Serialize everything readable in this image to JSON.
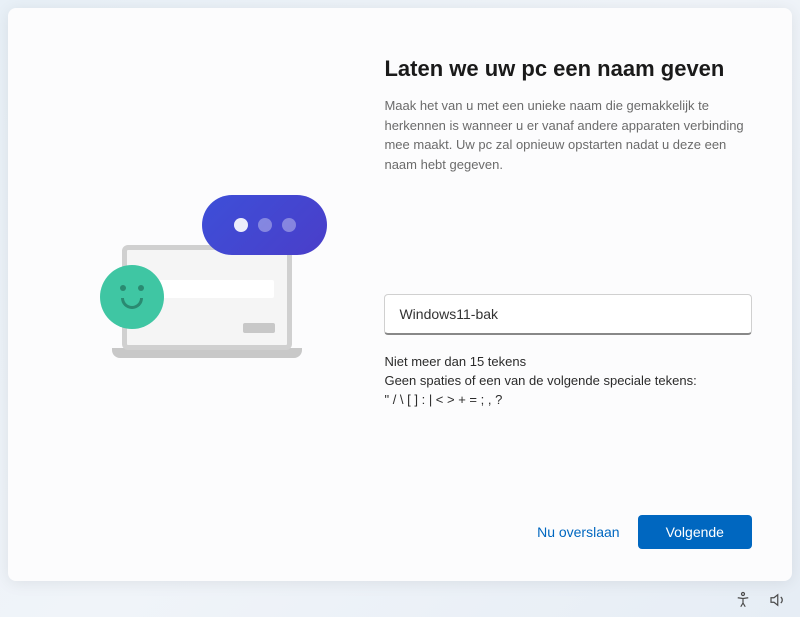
{
  "header": {
    "title": "Laten we uw pc een naam geven",
    "description": "Maak het van u met een unieke naam die gemakkelijk te herkennen is wanneer u er vanaf andere apparaten verbinding mee maakt. Uw pc zal opnieuw opstarten nadat u deze een naam hebt gegeven."
  },
  "form": {
    "pc_name_value": "Windows11-bak",
    "constraint_line1": "Niet meer dan 15 tekens",
    "constraint_line2": "Geen spaties of een van de volgende speciale tekens:",
    "constraint_line3": "\" / \\ [ ] : | < > + = ; , ?"
  },
  "footer": {
    "skip_label": "Nu overslaan",
    "next_label": "Volgende"
  }
}
